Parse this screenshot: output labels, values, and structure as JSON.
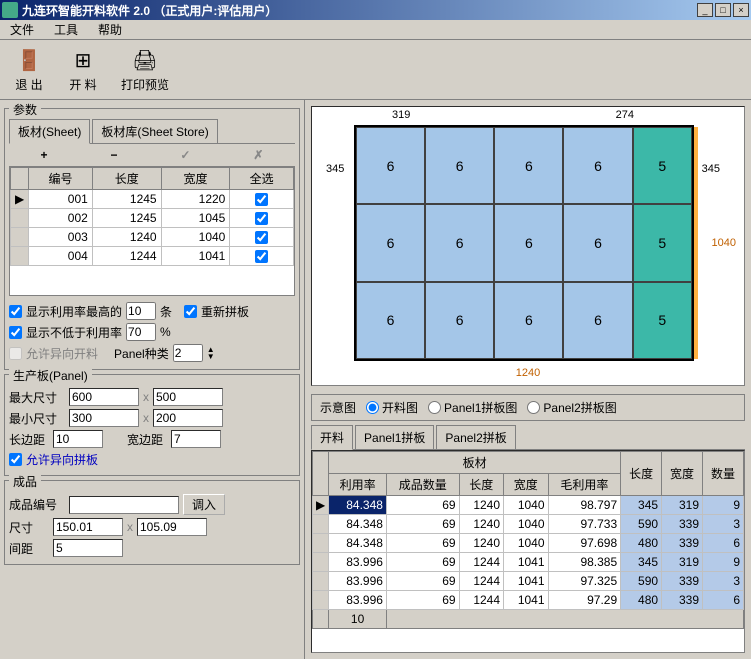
{
  "title": "九连环智能开料软件 2.0 （正式用户:评估用户）",
  "menu": {
    "file": "文件",
    "tools": "工具",
    "help": "帮助"
  },
  "toolbar": {
    "exit": "退 出",
    "cut": "开 料",
    "print": "打印预览"
  },
  "params": {
    "title": "参数",
    "tabs": {
      "sheet": "板材(Sheet)",
      "store": "板材库(Sheet Store)"
    },
    "cols": {
      "id": "编号",
      "len": "长度",
      "wid": "宽度",
      "all": "全选"
    },
    "rows": [
      {
        "id": "001",
        "len": "1245",
        "wid": "1220",
        "chk": true,
        "sel": true
      },
      {
        "id": "002",
        "len": "1245",
        "wid": "1045",
        "chk": true
      },
      {
        "id": "003",
        "len": "1240",
        "wid": "1040",
        "chk": true
      },
      {
        "id": "004",
        "len": "1244",
        "wid": "1041",
        "chk": true
      }
    ],
    "show_top": "显示利用率最高的",
    "show_top_v": "10",
    "show_top_u": "条",
    "recalc": "重新拼板",
    "show_min": "显示不低于利用率",
    "show_min_v": "70",
    "show_min_u": "%",
    "allow_hetero": "允许异向开料",
    "panel_types": "Panel种类",
    "panel_types_v": "2"
  },
  "panel": {
    "title": "生产板(Panel)",
    "max": "最大尺寸",
    "max_w": "600",
    "max_h": "500",
    "min": "最小尺寸",
    "min_w": "300",
    "min_h": "200",
    "long": "长边距",
    "long_v": "10",
    "wide": "宽边距",
    "wide_v": "7",
    "allow_diff": "允许异向拼板"
  },
  "product": {
    "title": "成品",
    "id": "成品编号",
    "load": "调入",
    "size": "尺寸",
    "size_w": "150.01",
    "size_h": "105.09",
    "gap": "间距",
    "gap_v": "5"
  },
  "diagram": {
    "top1": "319",
    "top2": "274",
    "left": "345",
    "right1": "345",
    "right2": "1040",
    "bottom": "1240",
    "cells": [
      [
        "6",
        "6",
        "6",
        "6",
        "5"
      ],
      [
        "6",
        "6",
        "6",
        "6",
        "5"
      ],
      [
        "6",
        "6",
        "6",
        "6",
        "5"
      ]
    ]
  },
  "viewopts": {
    "label": "示意图",
    "cut": "开料图",
    "p1": "Panel1拼板图",
    "p2": "Panel2拼板图"
  },
  "result": {
    "tabs": {
      "cut": "开料",
      "p1": "Panel1拼板",
      "p2": "Panel2拼板"
    },
    "header_group": "板材",
    "cols": {
      "util": "利用率",
      "qty": "成品数量",
      "len": "长度",
      "wid": "宽度",
      "gross": "毛利用率",
      "plen": "长度",
      "pwid": "宽度",
      "pqty": "数量"
    },
    "rows": [
      {
        "util": "84.348",
        "qty": "69",
        "len": "1240",
        "wid": "1040",
        "gross": "98.797",
        "plen": "345",
        "pwid": "319",
        "pqty": "9",
        "sel": true
      },
      {
        "util": "84.348",
        "qty": "69",
        "len": "1240",
        "wid": "1040",
        "gross": "97.733",
        "plen": "590",
        "pwid": "339",
        "pqty": "3"
      },
      {
        "util": "84.348",
        "qty": "69",
        "len": "1240",
        "wid": "1040",
        "gross": "97.698",
        "plen": "480",
        "pwid": "339",
        "pqty": "6"
      },
      {
        "util": "83.996",
        "qty": "69",
        "len": "1244",
        "wid": "1041",
        "gross": "98.385",
        "plen": "345",
        "pwid": "319",
        "pqty": "9"
      },
      {
        "util": "83.996",
        "qty": "69",
        "len": "1244",
        "wid": "1041",
        "gross": "97.325",
        "plen": "590",
        "pwid": "339",
        "pqty": "3"
      },
      {
        "util": "83.996",
        "qty": "69",
        "len": "1244",
        "wid": "1041",
        "gross": "97.29",
        "plen": "480",
        "pwid": "339",
        "pqty": "6"
      }
    ],
    "footer": "10"
  }
}
